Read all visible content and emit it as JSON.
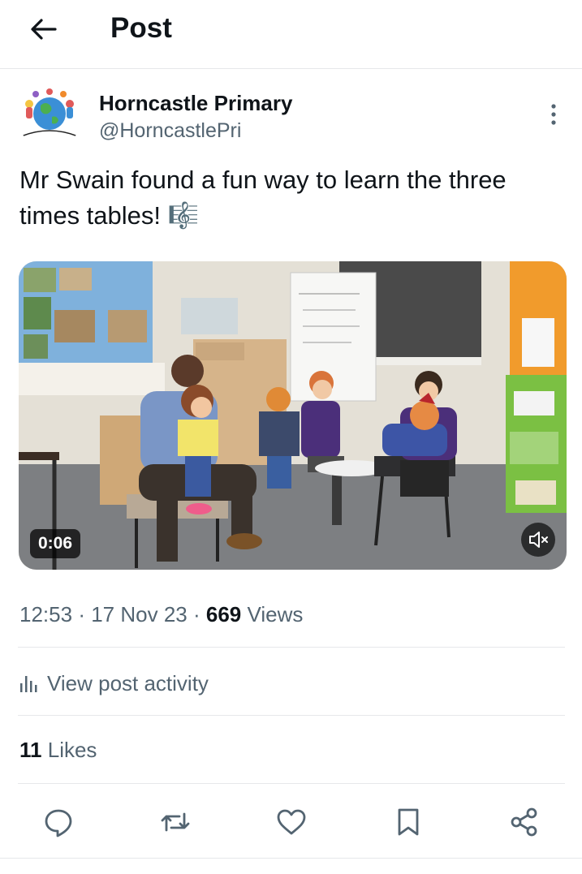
{
  "header": {
    "title": "Post"
  },
  "author": {
    "display_name": "Horncastle Primary",
    "handle": "@HorncastlePri"
  },
  "post": {
    "text": "Mr Swain found a fun way to learn the three times tables! 🎼"
  },
  "video": {
    "duration": "0:06"
  },
  "meta": {
    "time": "12:53",
    "date": "17 Nov 23",
    "views_count": "669",
    "views_label": "Views",
    "sep": "·"
  },
  "activity": {
    "label": "View post activity"
  },
  "likes": {
    "count": "11",
    "label": "Likes"
  },
  "icons": {
    "back": "arrow-left-icon",
    "more": "more-vertical-icon",
    "mute": "volume-mute-icon",
    "activity": "bar-chart-icon",
    "reply": "reply-icon",
    "repost": "repost-icon",
    "like": "heart-icon",
    "bookmark": "bookmark-icon",
    "share": "share-icon"
  },
  "colors": {
    "text": "#0f1419",
    "secondary": "#536471",
    "divider": "#e6e8ea"
  }
}
